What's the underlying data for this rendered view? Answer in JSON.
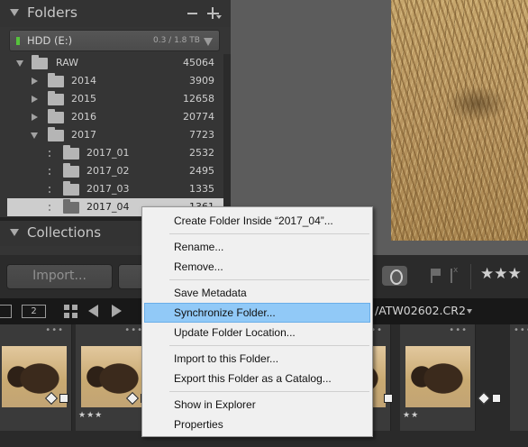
{
  "left_panel": {
    "folders_title": "Folders",
    "volume": {
      "name": "HDD (E:)",
      "size": "0.3 / 1.8 TB",
      "status_color": "#56c23c"
    },
    "folders": [
      {
        "name": "RAW",
        "count": "45064",
        "expanded": true
      },
      {
        "name": "2014",
        "count": "3909",
        "expanded": false
      },
      {
        "name": "2015",
        "count": "12658",
        "expanded": false
      },
      {
        "name": "2016",
        "count": "20774",
        "expanded": false
      },
      {
        "name": "2017",
        "count": "7723",
        "expanded": true
      },
      {
        "name": "2017_01",
        "count": "2532"
      },
      {
        "name": "2017_02",
        "count": "2495"
      },
      {
        "name": "2017_03",
        "count": "1335"
      },
      {
        "name": "2017_04",
        "count": "1361",
        "selected": true
      }
    ],
    "collections_title": "Collections"
  },
  "toolbar": {
    "import_label": "Import...",
    "rating": "★★★"
  },
  "filmbar": {
    "screen2_label": "2",
    "file_path": "/ATW02602.CR2"
  },
  "filmstrip": {
    "items": [
      {
        "more": "•••",
        "stars": ""
      },
      {
        "more": "•••",
        "stars": "★★★"
      },
      {
        "more": "•••",
        "stars": ""
      },
      {
        "more": "•••",
        "stars": "★★"
      },
      {
        "more": "•••",
        "stars": ""
      }
    ]
  },
  "context_menu": {
    "accent": "#91c9f7",
    "items": [
      "Create Folder Inside “2017_04”...",
      "Rename...",
      "Remove...",
      "Save Metadata",
      "Synchronize Folder...",
      "Update Folder Location...",
      "Import to this Folder...",
      "Export this Folder as a Catalog...",
      "Show in Explorer",
      "Properties"
    ]
  }
}
